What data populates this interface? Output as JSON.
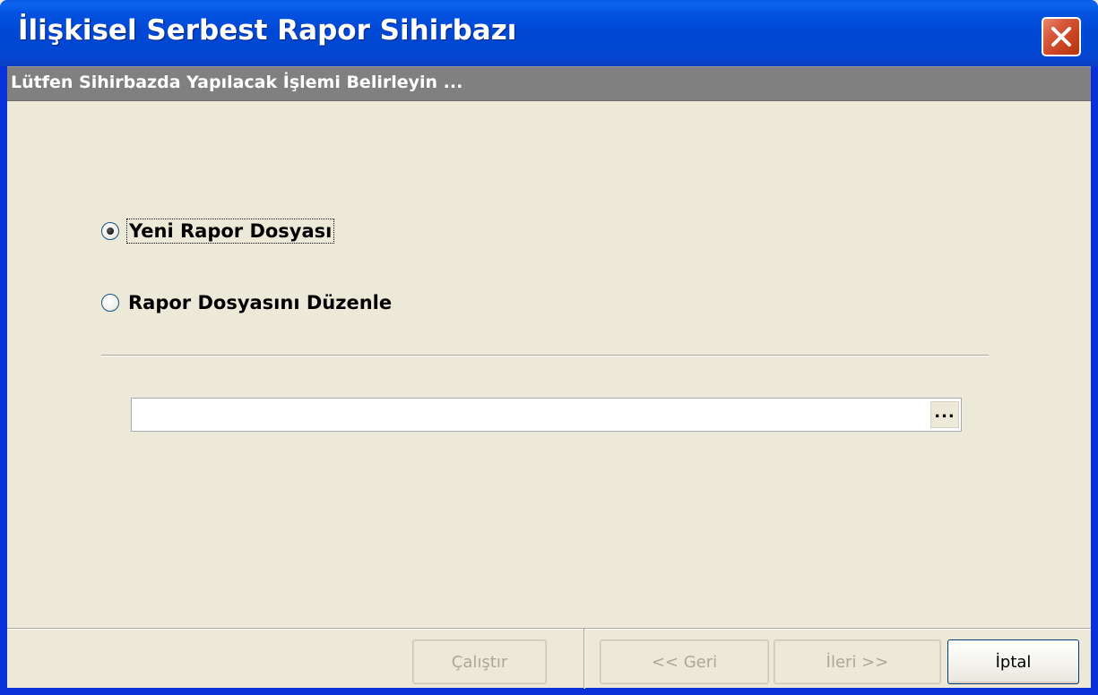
{
  "window": {
    "title": "İlişkisel Serbest Rapor Sihirbazı"
  },
  "subheader": {
    "text": "Lütfen Sihirbazda Yapılacak İşlemi Belirleyin ..."
  },
  "options": [
    {
      "label": "Yeni Rapor Dosyası",
      "selected": true
    },
    {
      "label": "Rapor Dosyasını Düzenle",
      "selected": false
    }
  ],
  "file_field": {
    "value": "",
    "browse_label": "..."
  },
  "buttons": {
    "run": "Çalıştır",
    "back": "<< Geri",
    "next": "İleri >>",
    "cancel": "İptal"
  },
  "icons": {
    "close": "close-icon"
  }
}
